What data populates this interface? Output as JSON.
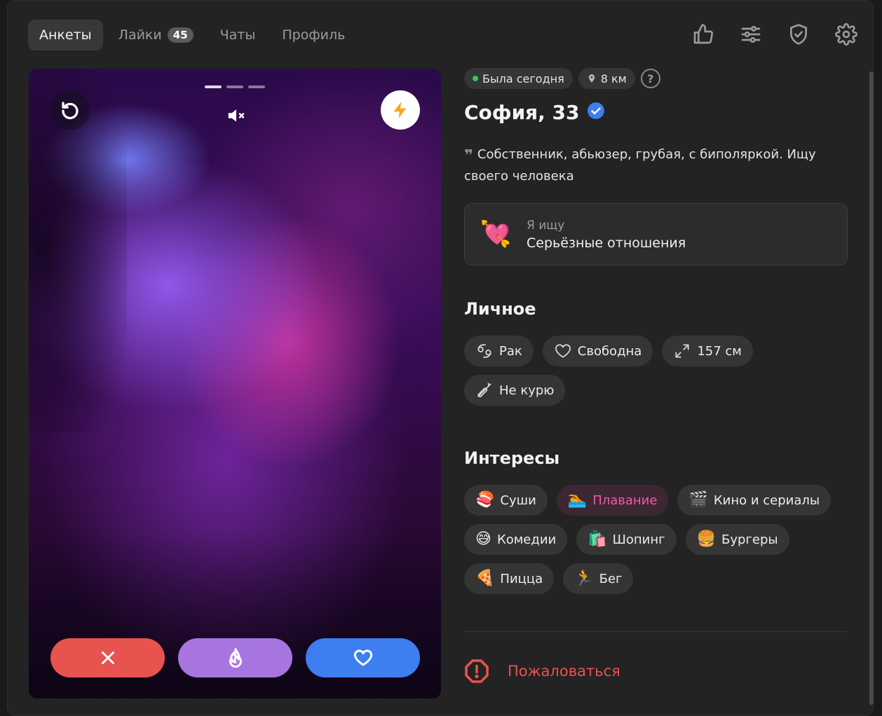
{
  "nav": {
    "tabs": [
      {
        "label": "Анкеты",
        "active": true
      },
      {
        "label": "Лайки",
        "badge": "45"
      },
      {
        "label": "Чаты"
      },
      {
        "label": "Профиль"
      }
    ],
    "icons": [
      "thumbs-up-icon",
      "sliders-icon",
      "shield-check-icon",
      "gear-icon"
    ]
  },
  "photo": {
    "count": 3,
    "current": 1,
    "controls": [
      "rewind-icon",
      "mute-icon",
      "lightning-icon"
    ],
    "actions": [
      "close-icon",
      "flame-icon",
      "heart-icon"
    ],
    "colors": {
      "dislike": "#e8524f",
      "superlike": "#a775e0",
      "like": "#3d7ef0"
    }
  },
  "profile": {
    "status": "Была сегодня",
    "distance": "8 км",
    "help": "?",
    "name_age": "София, 33",
    "verified": true,
    "bio_quote": "❞",
    "bio": "Собственник, абьюзер, грубая, с биполяркой. Ищу своего человека",
    "looking_for": {
      "emoji": "💘",
      "label": "Я ищу",
      "value": "Серьёзные отношения"
    },
    "personal_title": "Личное",
    "personal": [
      {
        "icon": "cancer-zodiac-icon",
        "label": "Рак"
      },
      {
        "icon": "heart-outline-icon",
        "label": "Свободна"
      },
      {
        "icon": "expand-arrows-icon",
        "label": "157 см"
      },
      {
        "icon": "no-smoking-icon",
        "label": "Не курю"
      }
    ],
    "interests_title": "Интересы",
    "interests": [
      {
        "emoji": "🍣",
        "label": "Суши",
        "highlight": false
      },
      {
        "emoji": "🏊",
        "label": "Плавание",
        "highlight": true
      },
      {
        "emoji": "🎬",
        "label": "Кино и сериалы",
        "highlight": false
      },
      {
        "emoji": "😅",
        "label": "Комедии",
        "highlight": false
      },
      {
        "emoji": "🛍️",
        "label": "Шопинг",
        "highlight": false
      },
      {
        "emoji": "🍔",
        "label": "Бургеры",
        "highlight": false
      },
      {
        "emoji": "🍕",
        "label": "Пицца",
        "highlight": false
      },
      {
        "emoji": "🏃",
        "label": "Бег",
        "highlight": false
      }
    ],
    "report_label": "Пожаловаться",
    "colors": {
      "highlight": "#f05aa8",
      "report": "#e8524f",
      "verified": "#3d7ef0",
      "online": "#34c759"
    }
  }
}
